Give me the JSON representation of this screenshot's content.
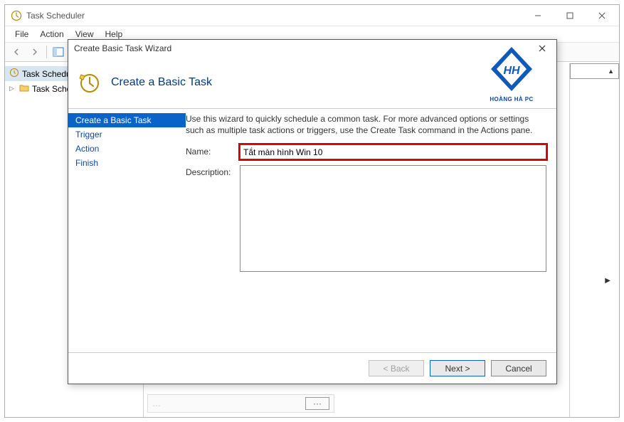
{
  "app": {
    "title": "Task Scheduler",
    "menu": [
      "File",
      "Action",
      "View",
      "Help"
    ]
  },
  "tree": {
    "root": "Task Scheduler",
    "child": "Task Scheduler Library"
  },
  "wizard": {
    "title": "Create Basic Task Wizard",
    "heading": "Create a Basic Task",
    "brand": "HOÀNG HÀ PC",
    "intro": "Use this wizard to quickly schedule a common task.  For more advanced options or settings such as multiple task actions or triggers, use the Create Task command in the Actions pane.",
    "steps": [
      "Create a Basic Task",
      "Trigger",
      "Action",
      "Finish"
    ],
    "labels": {
      "name": "Name:",
      "description": "Description:"
    },
    "values": {
      "name": "Tắt màn hình Win 10",
      "description": ""
    },
    "buttons": {
      "back": "< Back",
      "next": "Next >",
      "cancel": "Cancel"
    }
  }
}
